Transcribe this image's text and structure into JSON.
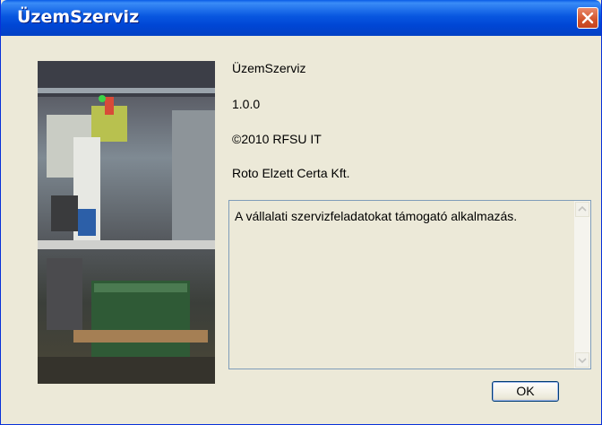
{
  "window": {
    "title": "ÜzemSzerviz"
  },
  "about": {
    "product_name": "ÜzemSzerviz",
    "version": "1.0.0",
    "copyright": "©2010 RFSU IT",
    "company": "Roto Elzett Certa Kft.",
    "description": "A vállalati szervizfeladatokat támogató alkalmazás."
  },
  "buttons": {
    "ok_label": "OK"
  },
  "icons": {
    "close": "close-icon",
    "scroll_up": "scroll-up-icon",
    "scroll_down": "scroll-down-icon"
  },
  "colors": {
    "titlebar": "#0857e0",
    "close_button": "#d2532b",
    "dialog_face": "#ece9d8",
    "border": "#7f9db9"
  }
}
